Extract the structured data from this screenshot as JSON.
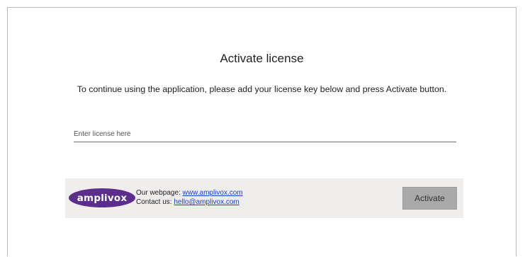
{
  "dialog": {
    "title": "Activate license",
    "instructions": "To continue using the application, please add your license key below and press Activate button.",
    "license_input": {
      "placeholder": "Enter license here",
      "value": ""
    }
  },
  "footer": {
    "logo_text": "amplivox",
    "webpage_label": "Our webpage: ",
    "webpage_link": "www.amplivox.com",
    "contact_label": "Contact us: ",
    "contact_link": "hello@amplivox.com",
    "activate_label": "Activate"
  },
  "colors": {
    "logo_purple": "#5b2d8c",
    "link_blue": "#1a3fd6",
    "footer_bg": "#f0eded",
    "button_gray": "#a9a9a9"
  }
}
